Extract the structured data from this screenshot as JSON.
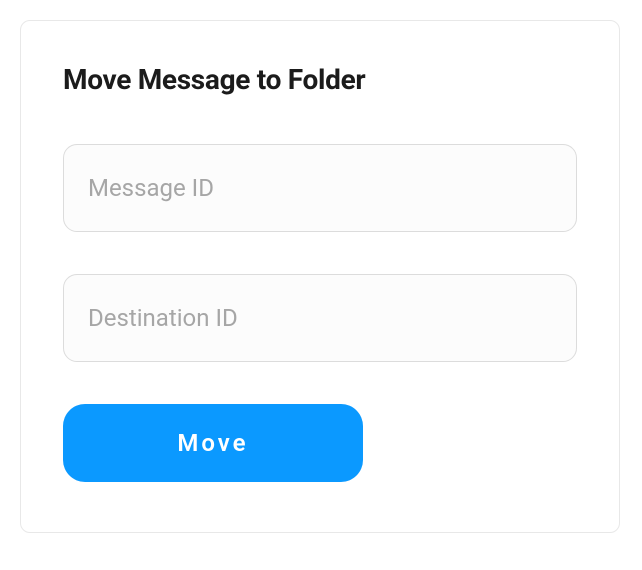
{
  "form": {
    "title": "Move Message to Folder",
    "message_id": {
      "placeholder": "Message ID",
      "value": ""
    },
    "destination_id": {
      "placeholder": "Destination ID",
      "value": ""
    },
    "submit_label": "Move"
  }
}
